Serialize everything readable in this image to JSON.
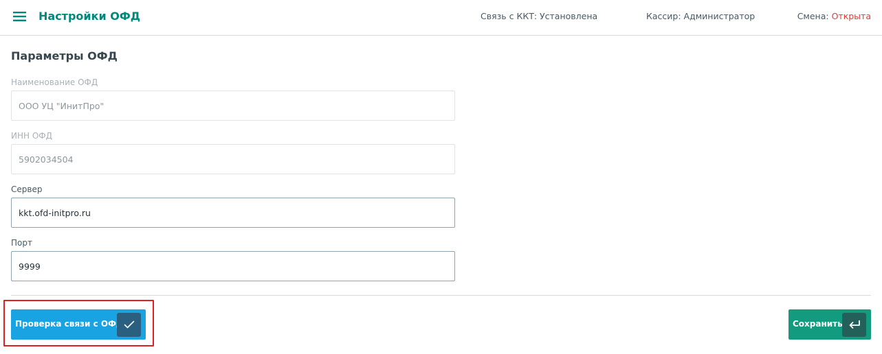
{
  "header": {
    "title": "Настройки ОФД",
    "connection": "Связь с ККТ: Установлена",
    "cashier": "Кассир: Администратор",
    "shift_label": "Смена: ",
    "shift_value": "Открыта",
    "shift_value_color": "#e53935",
    "title_color": "#00897b"
  },
  "form": {
    "section_title": "Параметры ОФД",
    "fields": [
      {
        "label": "Наименование ОФД",
        "value": "ООО УЦ \"ИнитПро\"",
        "disabled": true
      },
      {
        "label": "ИНН ОФД",
        "value": "5902034504",
        "disabled": true
      },
      {
        "label": "Сервер",
        "value": "kkt.ofd-initpro.ru",
        "disabled": false
      },
      {
        "label": "Порт",
        "value": "9999",
        "disabled": false
      }
    ]
  },
  "actions": {
    "check_label": "Проверка связи с ОФД",
    "check_icon": "check-icon",
    "check_color": "#1aa3e3",
    "save_label": "Сохранить",
    "save_icon": "enter-icon",
    "save_color": "#139b80"
  }
}
